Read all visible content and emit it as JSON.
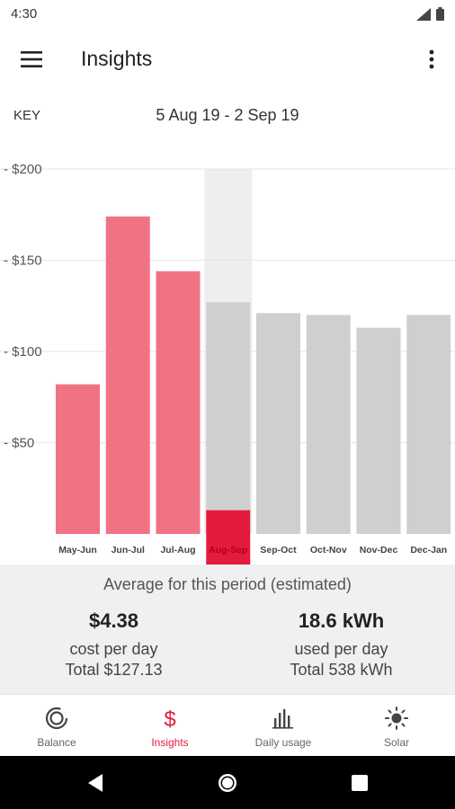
{
  "status_bar": {
    "time": "4:30",
    "icons": [
      "signal-icon",
      "battery-icon"
    ]
  },
  "app_bar": {
    "title": "Insights",
    "menu_icon": "hamburger-menu-icon",
    "more_icon": "more-vertical-icon"
  },
  "key_label": "KEY",
  "period": "5 Aug 19 - 2 Sep 19",
  "colors": {
    "past_bar": "#f07383",
    "forecast_bar": "#cfcfcf",
    "selected_highlight": "#eeeeee",
    "selected_label_bg": "#e31c3d",
    "accent": "#e31c3d"
  },
  "chart_data": {
    "type": "bar",
    "categories": [
      "May-Jun",
      "Jun-Jul",
      "Jul-Aug",
      "Aug-Sep",
      "Sep-Oct",
      "Oct-Nov",
      "Nov-Dec",
      "Dec-Jan"
    ],
    "values": [
      82,
      174,
      144,
      127,
      121,
      120,
      113,
      120
    ],
    "bar_kinds": [
      "actual",
      "actual",
      "actual",
      "forecast",
      "forecast",
      "forecast",
      "forecast",
      "forecast"
    ],
    "selected_index": 3,
    "selected_actual_value": 13,
    "y_ticks": [
      {
        "value": 200,
        "label": "$200"
      },
      {
        "value": 150,
        "label": "$150"
      },
      {
        "value": 100,
        "label": "$100"
      },
      {
        "value": 50,
        "label": "$50"
      }
    ],
    "ylim": [
      0,
      200
    ],
    "grid": true
  },
  "summary": {
    "heading": "Average for this period (estimated)",
    "cost": {
      "value": "$4.38",
      "label": "cost per day",
      "total": "Total $127.13"
    },
    "usage": {
      "value": "18.6 kWh",
      "label": "used per day",
      "total": "Total 538 kWh"
    }
  },
  "bottom_nav": [
    {
      "label": "Balance",
      "icon": "balance-ring-icon",
      "active": false
    },
    {
      "label": "Insights",
      "icon": "dollar-icon",
      "active": true
    },
    {
      "label": "Daily usage",
      "icon": "bar-chart-icon",
      "active": false
    },
    {
      "label": "Solar",
      "icon": "sun-icon",
      "active": false
    }
  ],
  "system_nav": [
    "back-icon",
    "home-icon",
    "recents-icon"
  ]
}
